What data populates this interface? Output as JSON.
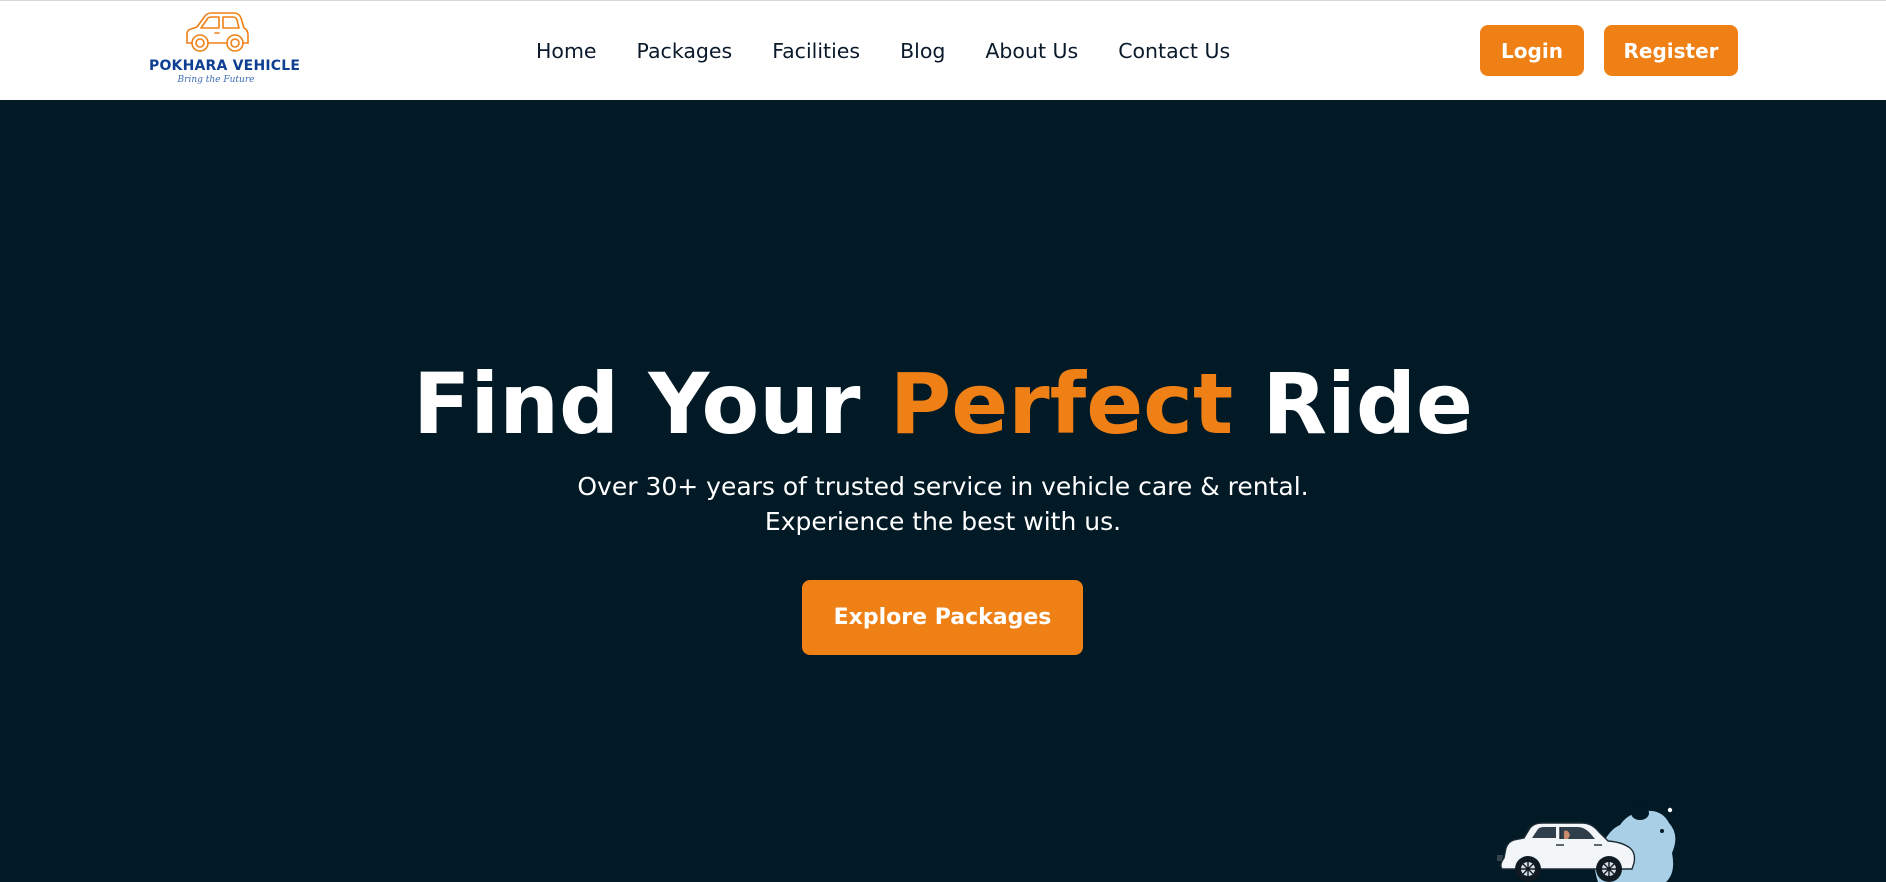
{
  "navbar": {
    "logo": {
      "name": "POKHARA VEHICLE",
      "tagline": "Bring the Future",
      "primary_color": "#0e3f92",
      "icon": "car-outline-icon"
    },
    "links": [
      {
        "label": "Home"
      },
      {
        "label": "Packages"
      },
      {
        "label": "Facilities"
      },
      {
        "label": "Blog"
      },
      {
        "label": "About Us"
      },
      {
        "label": "Contact Us"
      }
    ],
    "login_label": "Login",
    "register_label": "Register"
  },
  "hero": {
    "title_part1": "Find Your ",
    "title_highlight": "Perfect",
    "title_part2": " Ride",
    "subtitle_line1": "Over 30+ years of trusted service in vehicle care & rental.",
    "subtitle_line2": "Experience the best with us.",
    "cta_label": "Explore Packages",
    "illustration": "car-splash-illustration"
  },
  "colors": {
    "accent": "#ef8016",
    "background": "#021926",
    "navbar_bg": "#ffffff",
    "nav_text": "#0b1a2b"
  }
}
